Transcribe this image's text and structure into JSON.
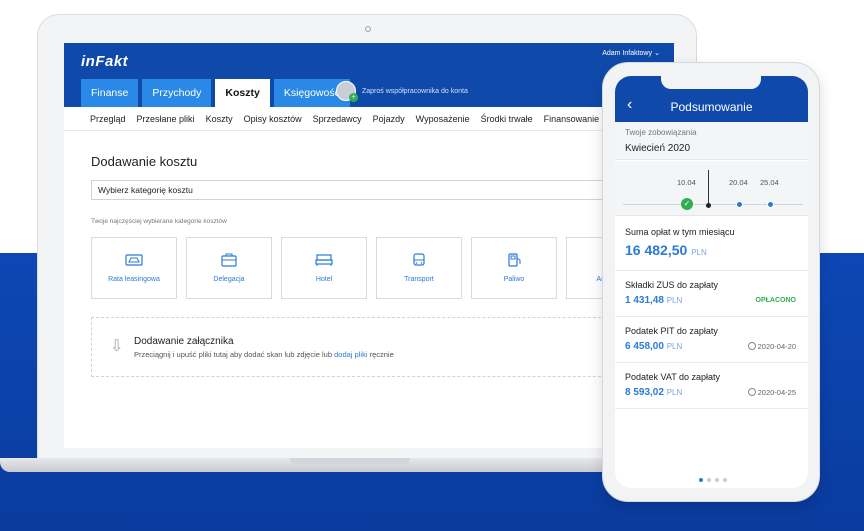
{
  "app": {
    "logo": "inFakt",
    "user": "Adam Infaktowy",
    "invite": "Zaproś współpracownika do konta"
  },
  "main_tabs": [
    {
      "label": "Finanse",
      "active": false
    },
    {
      "label": "Przychody",
      "active": false
    },
    {
      "label": "Koszty",
      "active": true
    },
    {
      "label": "Księgowość",
      "active": false
    }
  ],
  "sub_nav": [
    "Przegląd",
    "Przesłane pliki",
    "Koszty",
    "Opisy kosztów",
    "Sprzedawcy",
    "Pojazdy",
    "Wyposażenie",
    "Środki trwałe",
    "Finansowanie"
  ],
  "page": {
    "title": "Dodawanie kosztu",
    "category_select": "Wybierz kategorię kosztu",
    "hint": "Twoje najczęściej wybierane kategorie kosztów"
  },
  "tiles": [
    {
      "label": "Rata leasingowa",
      "icon": "car-icon"
    },
    {
      "label": "Delegacja",
      "icon": "briefcase-icon"
    },
    {
      "label": "Hotel",
      "icon": "bed-icon"
    },
    {
      "label": "Transport",
      "icon": "bus-icon"
    },
    {
      "label": "Paliwo",
      "icon": "fuel-icon"
    },
    {
      "label": "Artykuły",
      "icon": "phone-icon"
    }
  ],
  "attachment": {
    "title": "Dodawanie załącznika",
    "desc_before": "Przeciągnij i upuść pliki tutaj aby dodać skan lub zdjęcie lub ",
    "link": "dodaj pliki",
    "desc_after": " ręcznie"
  },
  "phone": {
    "title": "Podsumowanie",
    "obligations_label": "Twoje zobowiązania",
    "month": "Kwiecień 2020",
    "timeline_dates": [
      "10.04",
      "20.04",
      "25.04"
    ],
    "monthly_label": "Suma opłat w tym miesiącu",
    "monthly_amount": "16 482,50",
    "currency": "PLN",
    "rows": [
      {
        "label": "Składki ZUS do zapłaty",
        "amount": "1 431,48",
        "status": "OPŁACONO"
      },
      {
        "label": "Podatek PIT do zapłaty",
        "amount": "6 458,00",
        "date": "2020-04-20"
      },
      {
        "label": "Podatek VAT do zapłaty",
        "amount": "8 593,02",
        "date": "2020-04-25"
      }
    ]
  },
  "colors": {
    "brand": "#0f4aab",
    "accent": "#2a7ad8",
    "tab": "#2a89e6",
    "success": "#2fae52"
  }
}
